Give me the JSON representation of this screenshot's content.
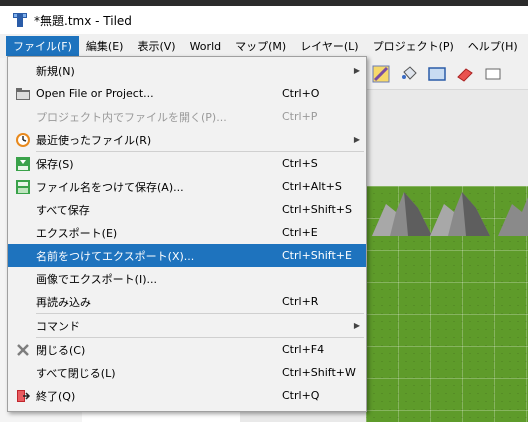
{
  "window": {
    "title": "*無題.tmx - Tiled"
  },
  "menubar": {
    "items": [
      {
        "label": "ファイル(F)",
        "active": true
      },
      {
        "label": "編集(E)"
      },
      {
        "label": "表示(V)"
      },
      {
        "label": "World"
      },
      {
        "label": "マップ(M)"
      },
      {
        "label": "レイヤー(L)"
      },
      {
        "label": "プロジェクト(P)"
      },
      {
        "label": "ヘルプ(H)"
      }
    ]
  },
  "file_menu": {
    "items": [
      {
        "label": "新規(N)",
        "shortcut": "",
        "submenu": true
      },
      {
        "label": "Open File or Project...",
        "shortcut": "Ctrl+O",
        "icon": "folder-open-icon"
      },
      {
        "label": "プロジェクト内でファイルを開く(P)...",
        "shortcut": "Ctrl+P",
        "disabled": true
      },
      {
        "label": "最近使ったファイル(R)",
        "shortcut": "",
        "submenu": true,
        "icon": "recent-icon"
      },
      {
        "label": "保存(S)",
        "shortcut": "Ctrl+S",
        "icon": "save-icon"
      },
      {
        "label": "ファイル名をつけて保存(A)...",
        "shortcut": "Ctrl+Alt+S",
        "icon": "save-as-icon"
      },
      {
        "label": "すべて保存",
        "shortcut": "Ctrl+Shift+S"
      },
      {
        "label": "エクスポート(E)",
        "shortcut": "Ctrl+E"
      },
      {
        "label": "名前をつけてエクスポート(X)...",
        "shortcut": "Ctrl+Shift+E",
        "highlighted": true
      },
      {
        "label": "画像でエクスポート(I)...",
        "shortcut": ""
      },
      {
        "label": "再読み込み",
        "shortcut": "Ctrl+R"
      },
      {
        "label": "コマンド",
        "shortcut": "",
        "submenu": true
      },
      {
        "label": "閉じる(C)",
        "shortcut": "Ctrl+F4",
        "icon": "close-icon"
      },
      {
        "label": "すべて閉じる(L)",
        "shortcut": "Ctrl+Shift+W"
      },
      {
        "label": "終了(Q)",
        "shortcut": "Ctrl+Q",
        "icon": "exit-icon"
      }
    ]
  },
  "colors": {
    "accent": "#1e73be",
    "menu_bg": "#f2f2f2",
    "grass": "#5e9b2a"
  }
}
